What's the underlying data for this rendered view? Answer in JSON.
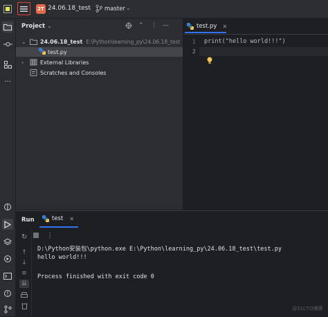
{
  "titlebar": {
    "project_badge": "2T",
    "project_name": "24.06.18_test",
    "branch": "master"
  },
  "project_panel": {
    "title": "Project",
    "tree": [
      {
        "label": "24.06.18_test",
        "path": "E:\\Python\\learning_py\\24.06.18_test"
      },
      {
        "label": "test.py"
      },
      {
        "label": "External Libraries"
      },
      {
        "label": "Scratches and Consoles"
      }
    ]
  },
  "editor": {
    "tab_label": "test.py",
    "line_numbers": [
      "1",
      "2"
    ],
    "code": "print(\"hello world!!!\")"
  },
  "run_panel": {
    "title": "Run",
    "tab_label": "test",
    "console_lines": [
      "D:\\Python安装包\\python.exe E:\\Python\\learning_py\\24.06.18_test\\test.py",
      "hello world!!!",
      "",
      "Process finished with exit code 0"
    ]
  },
  "watermark": "@51CTO博客",
  "colors": {
    "accent": "#3574f0",
    "highlight_border": "#e0453a",
    "badge": "#e06a4a",
    "folder": "#9aa7b0"
  }
}
